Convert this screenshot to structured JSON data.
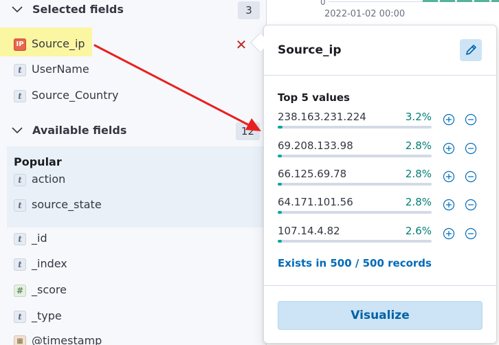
{
  "sidebar": {
    "selected_title": "Selected fields",
    "selected_count": "3",
    "selected_fields": [
      {
        "name": "Source_ip",
        "type": "ip",
        "token": "IP"
      },
      {
        "name": "UserName",
        "type": "string",
        "token": "t"
      },
      {
        "name": "Source_Country",
        "type": "string",
        "token": "t"
      }
    ],
    "available_title": "Available fields",
    "available_count": "12",
    "popular_title": "Popular",
    "popular_fields": [
      {
        "name": "action",
        "type": "string",
        "token": "t"
      },
      {
        "name": "source_state",
        "type": "string",
        "token": "t"
      }
    ],
    "other_fields": [
      {
        "name": "_id",
        "type": "string",
        "token": "t"
      },
      {
        "name": "_index",
        "type": "string",
        "token": "t"
      },
      {
        "name": "_score",
        "type": "number",
        "token": "#"
      },
      {
        "name": "_type",
        "type": "string",
        "token": "t"
      },
      {
        "name": "@timestamp",
        "type": "date",
        "token": "▦"
      }
    ]
  },
  "background": {
    "zero_tick": "0",
    "date_label": "2022-01-02 00:00"
  },
  "popover": {
    "title": "Source_ip",
    "top_values_title": "Top 5 values",
    "values": [
      {
        "value": "238.163.231.224",
        "percent": "3.2%",
        "fraction": 0.032
      },
      {
        "value": "69.208.133.98",
        "percent": "2.8%",
        "fraction": 0.028
      },
      {
        "value": "66.125.69.78",
        "percent": "2.8%",
        "fraction": 0.028
      },
      {
        "value": "64.171.101.56",
        "percent": "2.8%",
        "fraction": 0.028
      },
      {
        "value": "107.14.4.82",
        "percent": "2.6%",
        "fraction": 0.026
      }
    ],
    "exists_text": "Exists in 500 / 500 records",
    "visualize_label": "Visualize"
  },
  "colors": {
    "accent": "#006bb8",
    "percent": "#017d73",
    "bar_fill": "#00a69b",
    "remove": "#bd271e",
    "highlight": "#fbf6a1",
    "annotation_arrow": "#e8211f"
  }
}
